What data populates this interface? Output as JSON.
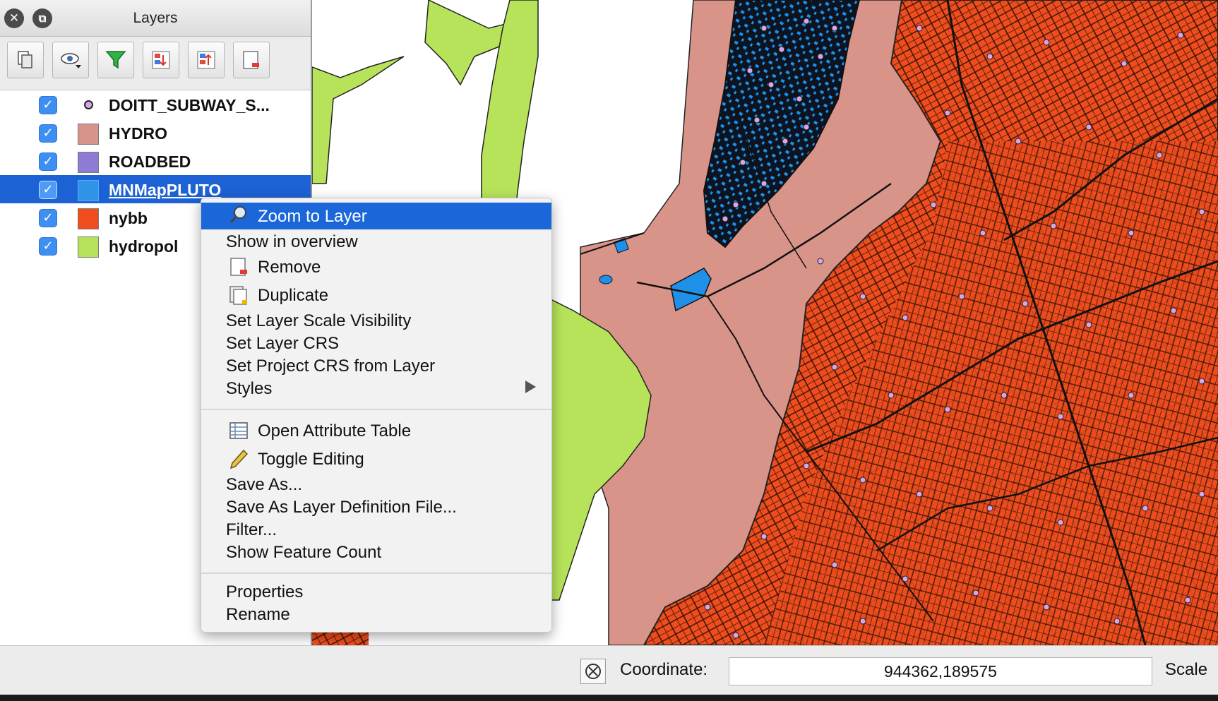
{
  "window": {
    "panel_title": "Layers",
    "close_glyph": "✕",
    "float_glyph": "⧉"
  },
  "toolbar": {
    "buttons": [
      {
        "icon": "add-group-icon"
      },
      {
        "icon": "manage-visibility-icon"
      },
      {
        "icon": "filter-legend-icon"
      },
      {
        "icon": "expand-all-icon"
      },
      {
        "icon": "collapse-all-icon"
      },
      {
        "icon": "remove-layer-icon"
      }
    ]
  },
  "layers": [
    {
      "name": "DOITT_SUBWAY_S...",
      "checked": true,
      "symbol": "point",
      "color": "#d8a6e6"
    },
    {
      "name": "HYDRO",
      "checked": true,
      "symbol": "fill",
      "color": "#d9948a"
    },
    {
      "name": "ROADBED",
      "checked": true,
      "symbol": "fill",
      "color": "#8e7bd6"
    },
    {
      "name": "MNMapPLUTO",
      "checked": true,
      "symbol": "fill",
      "color": "#2f93e6",
      "selected": true
    },
    {
      "name": "nybb",
      "checked": true,
      "symbol": "fill",
      "color": "#f04d1e"
    },
    {
      "name": "hydropol",
      "checked": true,
      "symbol": "fill",
      "color": "#b7e35b"
    }
  ],
  "check_glyph": "✓",
  "context_menu": {
    "items": [
      {
        "label": "Zoom to Layer",
        "icon": "zoom-layer-icon",
        "highlighted": true
      },
      {
        "label": "Show in overview"
      },
      {
        "label": "Remove",
        "icon": "remove-icon"
      },
      {
        "label": "Duplicate",
        "icon": "duplicate-icon"
      },
      {
        "label": "Set Layer Scale Visibility"
      },
      {
        "label": "Set Layer CRS"
      },
      {
        "label": "Set Project CRS from Layer"
      },
      {
        "label": "Styles",
        "submenu": true
      },
      {
        "label": "Open Attribute Table",
        "icon": "attribute-table-icon"
      },
      {
        "label": "Toggle Editing",
        "icon": "pencil-icon"
      },
      {
        "label": "Save As..."
      },
      {
        "label": "Save As Layer Definition File..."
      },
      {
        "label": "Filter..."
      },
      {
        "label": "Show Feature Count"
      },
      {
        "label": "Properties"
      },
      {
        "label": "Rename"
      }
    ]
  },
  "status_bar": {
    "coordinate_label": "Coordinate:",
    "coordinate_value": "944362,189575",
    "scale_label": "Scale"
  },
  "colors": {
    "selection": "#1d62d4",
    "menu_highlight": "#1b66d8",
    "hydro": "#d9948a",
    "nybb": "#f04d1e",
    "pluto": "#1e90e8",
    "hydropol": "#b7e35b",
    "subway": "#d8a6e6"
  }
}
